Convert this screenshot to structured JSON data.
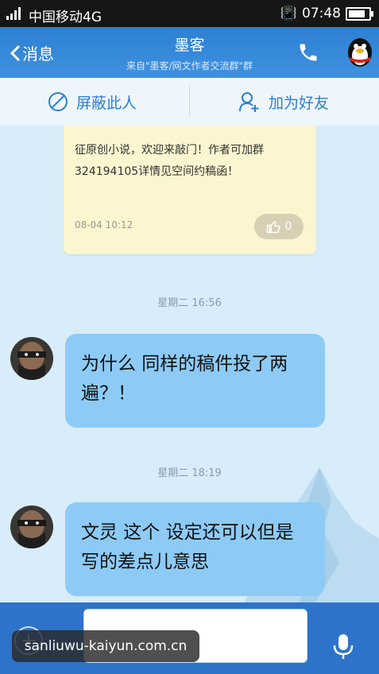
{
  "status": {
    "network": "4G",
    "carrier": "中国移动4G",
    "time": "07:48",
    "battery_level": 0.9
  },
  "header": {
    "back_label": "消息",
    "title": "墨客",
    "subtitle": "来自\"墨客/网文作者交流群\"群"
  },
  "actions": {
    "block_label": "屏蔽此人",
    "add_friend_label": "加为好友"
  },
  "note": {
    "text": "征原创小说，欢迎来敲门！作者可加群324194105详情见空间约稿函！",
    "time": "08-04 10:12",
    "like_count": "0"
  },
  "messages": [
    {
      "time": "星期二 16:56",
      "text": "为什么 同样的稿件投了两遍？！"
    },
    {
      "time": "星期二 18:19",
      "text": "文灵 这个  设定还可以但是写的差点儿意思"
    }
  ],
  "watermark": "sanliuwu-kaiyun.com.cn"
}
